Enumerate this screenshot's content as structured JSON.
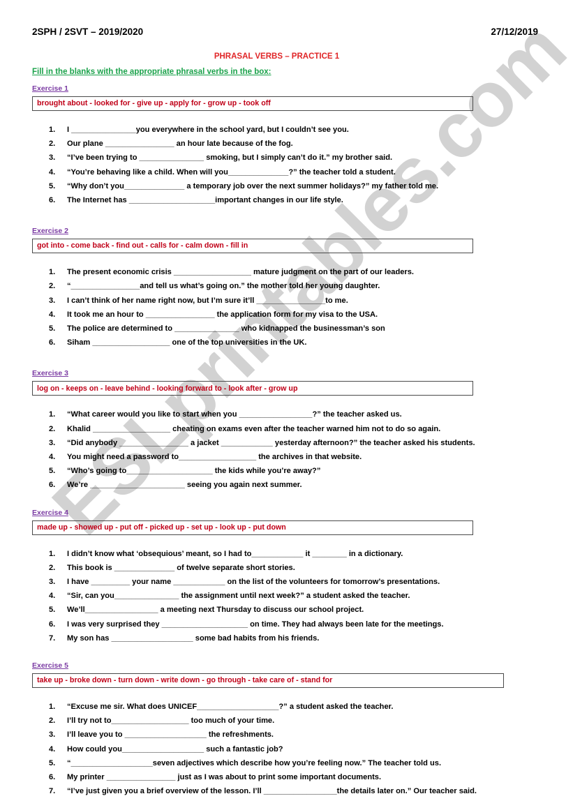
{
  "header": {
    "left": "2SPH / 2SVT – 2019/2020",
    "right": "27/12/2019"
  },
  "title": "PHRASAL VERBS – PRACTICE 1",
  "instruction": "Fill in the blanks with the appropriate phrasal verbs in the box:",
  "watermark": "ESLprintables.com",
  "colors": {
    "title_red": "#e02527",
    "box_word_red": "#c00018",
    "instruction_green": "#1aa24a",
    "exercise_purple": "#7b3ba3",
    "watermark_gray": "#d2d2d2",
    "box_border": "#4a4a4a"
  },
  "exercises": [
    {
      "label": "Exercise 1",
      "word_bank": "brought about  - looked for - give up  - apply for  -  grow up  -  took off",
      "items": [
        "I _______________you everywhere in the school yard, but I couldn’t see you.",
        "Our plane ________________ an hour late because of the fog.",
        "“I’ve been trying to _______________ smoking, but I simply can’t do it.” my brother said.",
        "“You’re behaving like a child. When will you______________?” the teacher told a student.",
        "“Why don’t you______________ a temporary job over the next summer holidays?” my father told me.",
        "The Internet has ____________________important changes in our life style."
      ]
    },
    {
      "label": "Exercise 2",
      "word_bank": "got into  -  come back  -  find out  - calls for - calm down - fill in",
      "items": [
        "The present economic crisis __________________ mature judgment on the part of our leaders.",
        "“________________and tell us what’s going on.” the mother told her young daughter.",
        "I can’t think of her name right now, but I’m sure it’ll ________________to me.",
        "It took me an hour to ________________ the application form for my visa to the USA.",
        "The police are determined to _______________ who kidnapped the businessman’s son",
        "Siham __________________ one of the top universities in the UK."
      ]
    },
    {
      "label": "Exercise 3",
      "word_bank": "log on  -  keeps on  -   leave behind  -   looking forward to  -   look after  -   grow up",
      "items": [
        "“What career would you like to start when you _________________?” the teacher asked us.",
        "Khalid __________________ cheating on exams even after the teacher warned him not to do so again.",
        "“Did anybody ________________ a jacket ____________ yesterday afternoon?” the teacher asked his students.",
        "You might need a password to__________________ the archives in that website.",
        "“Who’s going to____________________ the kids while you’re away?”",
        "We’re ______________________ seeing you again next summer."
      ]
    },
    {
      "label": "Exercise 4",
      "word_bank": "made up  -  showed up -  put off   -  picked up  - set up -   look up  -  put down",
      "items": [
        "I didn’t know what ‘obsequious’ meant, so I had to____________ it ________ in a dictionary.",
        "This book is ______________ of twelve separate short stories.",
        "I have _________ your name ____________ on the list of the volunteers for tomorrow’s presentations.",
        "“Sir, can you_______________ the assignment until next week?” a student asked the teacher.",
        "We’ll_________________ a meeting next Thursday to discuss our school project.",
        "I was very surprised they ____________________ on time. They had always been late for the meetings.",
        "My son has ___________________ some bad habits  from his friends."
      ]
    },
    {
      "label": "Exercise 5",
      "word_bank": "take up  -  broke down  -  turn down  -  write down  - go through  -  take care of  -  stand for",
      "items": [
        "“Excuse me sir. What does UNICEF___________________?” a student asked the teacher.",
        "I’ll try not to__________________ too much of your time.",
        "I’ll leave you to ___________________ the refreshments.",
        "How could you___________________ such a fantastic job?",
        "“___________________seven adjectives which describe how you’re feeling now.” The teacher told us.",
        "My printer ________________ just as I was about to print some important documents.",
        "“I’ve just given you a brief overview of the lesson. I’ll _________________the details later on.” Our teacher said."
      ]
    }
  ]
}
